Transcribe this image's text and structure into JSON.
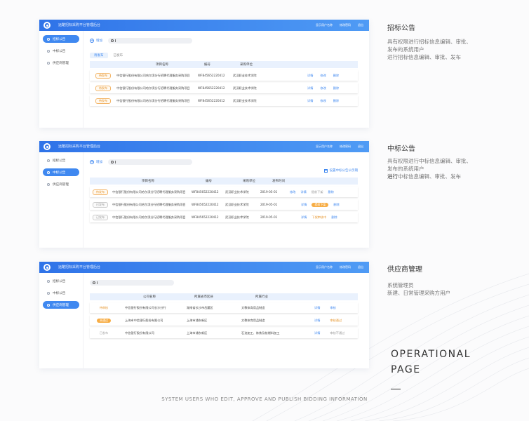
{
  "app": {
    "title": "远酷招标采购平台管理后台",
    "header_links": [
      "显示用户名称",
      "修改密码",
      "退出"
    ],
    "nav": [
      "招标公告",
      "中标公告",
      "供应商管理"
    ]
  },
  "panel1": {
    "add_label": "增加",
    "tabs": [
      "待发布",
      "已发布"
    ],
    "columns": [
      "项目名称",
      "编号",
      "采购单位"
    ],
    "rows": [
      {
        "tag": "待发布",
        "name": "中信银行股份有限公司哈尔滨分行招聘代理服务采购项目",
        "code": "WF845652220412",
        "unit": "武汉职业技术学院",
        "actions": [
          "详情",
          "修改",
          "删除"
        ]
      },
      {
        "tag": "待发布",
        "name": "中信银行股份有限公司哈尔滨分行招聘代理服务采购项目",
        "code": "WF845652220412",
        "unit": "武汉职业技术学院",
        "actions": [
          "详情",
          "修改",
          "删除"
        ]
      },
      {
        "tag": "待发布",
        "name": "中信银行股份有限公司哈尔滨分行招聘代理服务采购项目",
        "code": "WF845652220412",
        "unit": "武汉职业技术学院",
        "actions": [
          "详情",
          "修改",
          "删除"
        ]
      }
    ]
  },
  "panel2": {
    "add_label": "增加",
    "right_link": "设置中标公告公示期",
    "columns": [
      "项目名称",
      "编号",
      "采购单位",
      "发布时间"
    ],
    "rows": [
      {
        "tag": "待发布",
        "name": "中信银行股份有限公司哈尔滨分行招聘代理服务采购项目",
        "code": "WF845652220412",
        "unit": "武汉职业技术学院",
        "date": "2019-05-01",
        "actions": [
          "修改",
          "详情",
          "提前下架",
          "删除"
        ]
      },
      {
        "tag": "已发布",
        "name": "中信银行股份有限公司哈尔滨分行招聘代理服务采购项目",
        "code": "WF845652220412",
        "unit": "武汉职业技术学院",
        "date": "2019-05-01",
        "actions": [
          "",
          "详情",
          "提前下架",
          "删除"
        ]
      },
      {
        "tag": "已发布",
        "name": "中信银行股份有限公司哈尔滨分行招聘代理服务采购项目",
        "code": "WF845652220412",
        "unit": "武汉职业技术学院",
        "date": "2019-05-01",
        "actions": [
          "",
          "详情",
          "下架审核中",
          "删除"
        ]
      }
    ]
  },
  "panel3": {
    "columns": [
      "公司名称",
      "所属省市区县",
      "所属行业"
    ],
    "rows": [
      {
        "tag": "待审核",
        "name": "中信银行股份有限公司长沙分行",
        "region": "湖南省长沙市岳麓区",
        "industry": "文教体育用品制造",
        "actions": [
          "详情",
          "审核"
        ]
      },
      {
        "tag": "未通过",
        "name": "上海市中信银行股份有限公司",
        "region": "上海市浦东新区",
        "industry": "文教体育用品制造",
        "actions": [
          "详情",
          "审核通过"
        ]
      },
      {
        "tag": "已发布",
        "name": "中信银行股份有限公司",
        "region": "上海市浦东新区",
        "industry": "石油加工、炼焦及核燃料加工",
        "actions": [
          "详情",
          "审核不通过"
        ]
      }
    ]
  },
  "right": {
    "s1_title": "招标公告",
    "s1_lines": [
      "具有权限进行招标信息编辑、审批、",
      "发布的系统用户",
      "进行招标信息编辑、审批、发布"
    ],
    "s2_title": "中标公告",
    "s2_lines": [
      "具有权限进行中标信息编辑、审批、",
      "发布的系统用户"
    ],
    "s2_bold": "进行",
    "s2_rest": "中标信息编辑、审批、发布",
    "s3_title": "供应商管理",
    "s3_lines": [
      "系统管理员",
      "新建、日常管理采购方用户"
    ]
  },
  "operational": [
    "OPERATIONAL",
    "PAGE"
  ],
  "footer": "SYSTEM USERS WHO EDIT, APPROVE AND PUBLISH BIDDING INFORMATION"
}
